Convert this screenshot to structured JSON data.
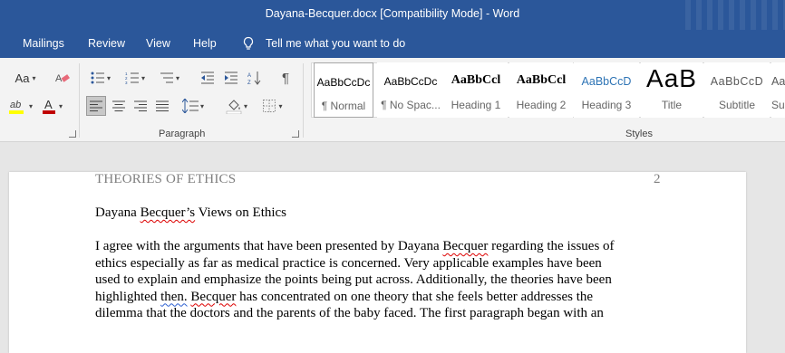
{
  "window": {
    "title": "Dayana-Becquer.docx [Compatibility Mode]  -  Word"
  },
  "menu": {
    "tabs": [
      "Mailings",
      "Review",
      "View",
      "Help"
    ],
    "tell_me": "Tell me what you want to do"
  },
  "ribbon": {
    "font_group": {
      "change_case": "Aa"
    },
    "paragraph_label": "Paragraph",
    "styles_label": "Styles",
    "styles": [
      {
        "preview": "AaBbCcDc",
        "name": "¶ Normal",
        "selected": true
      },
      {
        "preview": "AaBbCcDc",
        "name": "¶ No Spac..."
      },
      {
        "preview": "AaBbCcl",
        "name": "Heading 1"
      },
      {
        "preview": "AaBbCcl",
        "name": "Heading 2"
      },
      {
        "preview": "AaBbCcD",
        "name": "Heading 3"
      },
      {
        "preview": "AaB",
        "name": "Title"
      },
      {
        "preview": "AaBbCcD",
        "name": "Subtitle"
      },
      {
        "preview": "Aa",
        "name": "Su"
      }
    ]
  },
  "document": {
    "running_header": "THEORIES OF ETHICS",
    "page_number": "2",
    "heading": "Dayana Becquer’s Views on Ethics",
    "paragraph_lines": [
      "I agree with the arguments that have been presented by Dayana Becquer regarding the issues of",
      "ethics especially as far as medical practice is concerned. Very applicable examples have been",
      "used to explain and emphasize the points being put across. Additionally, the theories have been",
      "highlighted then. Becquer  has concentrated on one theory that she feels better addresses the",
      "dilemma that the doctors and the parents of the baby faced. The first paragraph began with an"
    ]
  },
  "colors": {
    "title_bar": "#2b579a",
    "ribbon_bg": "#f3f3f3",
    "doc_bg": "#e6e6e6",
    "font_color_red": "#c00000",
    "highlight_yellow": "#ffff00"
  }
}
